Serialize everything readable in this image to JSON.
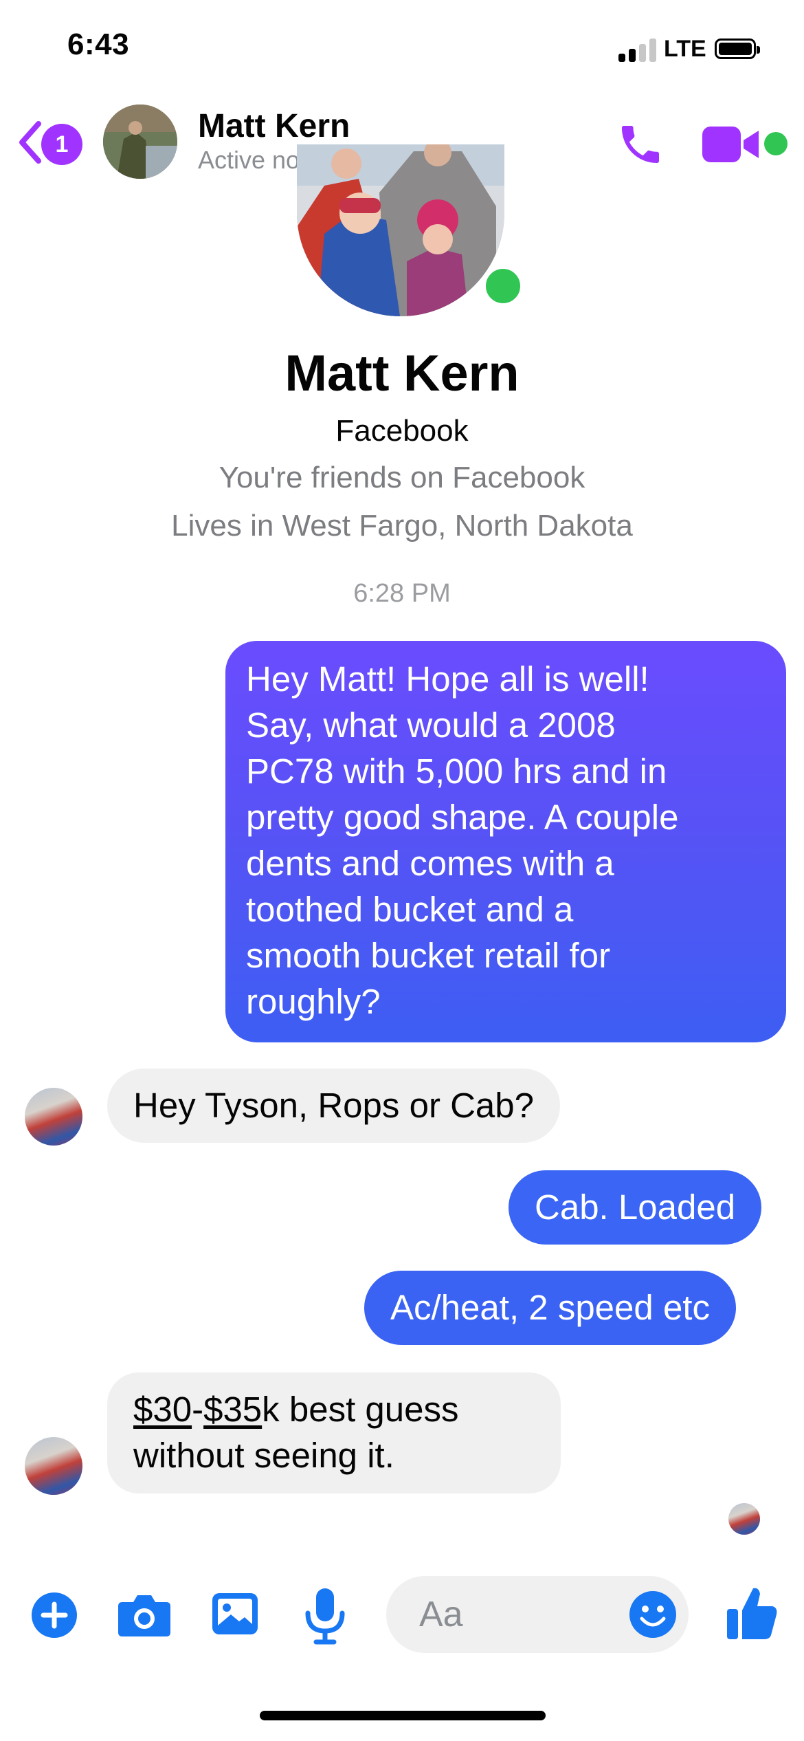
{
  "status_bar": {
    "time": "6:43",
    "network": "LTE"
  },
  "header": {
    "back_badge": "1",
    "name": "Matt Kern",
    "status": "Active now"
  },
  "profile": {
    "name": "Matt Kern",
    "platform": "Facebook",
    "friends": "You're friends on Facebook",
    "location": "Lives in West Fargo, North Dakota"
  },
  "timestamp": "6:28 PM",
  "messages": [
    {
      "side": "sent",
      "lines": [
        "Hey Matt!  Hope all is well!",
        "Say, what would a 2008",
        "PC78 with 5,000 hrs and in",
        "pretty good shape. A couple",
        "dents and comes with a",
        "toothed bucket and a",
        "smooth bucket retail for",
        "roughly?"
      ]
    },
    {
      "side": "received",
      "text": "Hey Tyson, Rops or Cab?"
    },
    {
      "side": "sent",
      "text": "Cab. Loaded"
    },
    {
      "side": "sent",
      "text": "Ac/heat, 2 speed etc"
    },
    {
      "side": "received",
      "parts": [
        "$30",
        "-",
        "$35",
        "k best guess"
      ],
      "line2": "without seeing it."
    }
  ],
  "composer": {
    "placeholder": "Aa"
  },
  "icons": [
    "back-chevron-icon",
    "call-icon",
    "video-camera-icon",
    "plus-icon",
    "camera-icon",
    "photo-gallery-icon",
    "microphone-icon",
    "emoji-icon",
    "thumbs-up-icon"
  ],
  "colors": {
    "accent_purple": "#a033ff",
    "messenger_blue": "#3b66f5",
    "online_green": "#31c553"
  }
}
